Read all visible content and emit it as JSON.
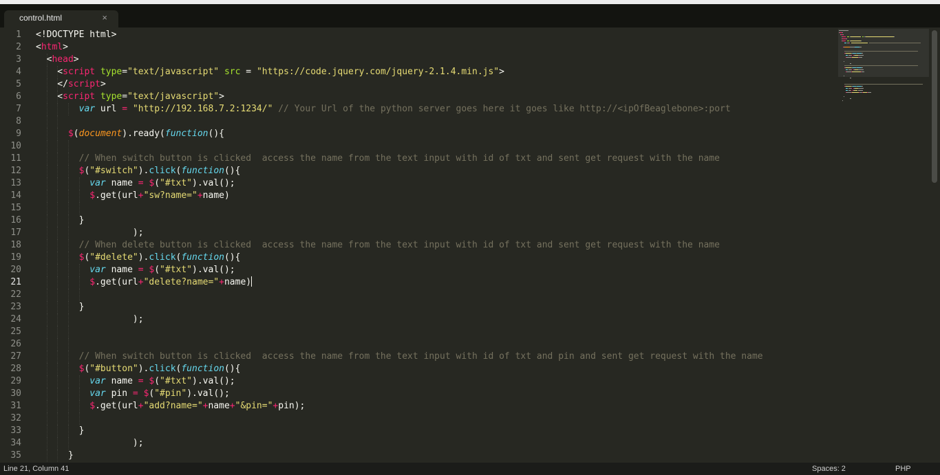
{
  "tab": {
    "title": "control.html",
    "close_glyph": "×"
  },
  "editor": {
    "active_line": 21,
    "lines": [
      {
        "n": "1",
        "tokens": [
          [
            "p",
            "<!DOCTYPE html>"
          ]
        ]
      },
      {
        "n": "2",
        "tokens": [
          [
            "p",
            "<"
          ],
          [
            "tag",
            "html"
          ],
          [
            "p",
            ">"
          ]
        ]
      },
      {
        "n": "3",
        "tokens": [
          [
            "p",
            "  <"
          ],
          [
            "tag",
            "head"
          ],
          [
            "p",
            ">"
          ]
        ]
      },
      {
        "n": "4",
        "tokens": [
          [
            "p",
            "    <"
          ],
          [
            "tag",
            "script"
          ],
          [
            "p",
            " "
          ],
          [
            "attr",
            "type"
          ],
          [
            "p",
            "="
          ],
          [
            "str",
            "\"text/javascript\""
          ],
          [
            "p",
            " "
          ],
          [
            "attr",
            "src"
          ],
          [
            "p",
            " = "
          ],
          [
            "str",
            "\"https://code.jquery.com/jquery-2.1.4.min.js\""
          ],
          [
            "p",
            ">"
          ]
        ]
      },
      {
        "n": "5",
        "tokens": [
          [
            "p",
            "    </"
          ],
          [
            "tag",
            "script"
          ],
          [
            "p",
            ">"
          ]
        ]
      },
      {
        "n": "6",
        "tokens": [
          [
            "p",
            "    <"
          ],
          [
            "tag",
            "script"
          ],
          [
            "p",
            " "
          ],
          [
            "attr",
            "type"
          ],
          [
            "p",
            "="
          ],
          [
            "str",
            "\"text/javascript\""
          ],
          [
            "p",
            ">"
          ]
        ]
      },
      {
        "n": "7",
        "tokens": [
          [
            "p",
            "        "
          ],
          [
            "kw",
            "var"
          ],
          [
            "p",
            " url "
          ],
          [
            "op",
            "="
          ],
          [
            "p",
            " "
          ],
          [
            "str",
            "\"http://192.168.7.2:1234/\""
          ],
          [
            "p",
            " "
          ],
          [
            "com",
            "// Your Url of the python server goes here it goes like http://<ipOfBeaglebone>:port"
          ]
        ]
      },
      {
        "n": "8",
        "tokens": []
      },
      {
        "n": "9",
        "tokens": [
          [
            "p",
            "      "
          ],
          [
            "op",
            "$"
          ],
          [
            "p",
            "("
          ],
          [
            "var",
            "document"
          ],
          [
            "p",
            ").ready("
          ],
          [
            "kw",
            "function"
          ],
          [
            "p",
            "(){"
          ]
        ]
      },
      {
        "n": "10",
        "tokens": []
      },
      {
        "n": "11",
        "tokens": [
          [
            "p",
            "        "
          ],
          [
            "com",
            "// When switch button is clicked  access the name from the text input with id of txt and sent get request with the name"
          ]
        ]
      },
      {
        "n": "12",
        "tokens": [
          [
            "p",
            "        "
          ],
          [
            "op",
            "$"
          ],
          [
            "p",
            "("
          ],
          [
            "str",
            "\"#switch\""
          ],
          [
            "p",
            ")."
          ],
          [
            "fn",
            "click"
          ],
          [
            "p",
            "("
          ],
          [
            "kw",
            "function"
          ],
          [
            "p",
            "(){"
          ]
        ]
      },
      {
        "n": "13",
        "tokens": [
          [
            "p",
            "          "
          ],
          [
            "kw",
            "var"
          ],
          [
            "p",
            " name "
          ],
          [
            "op",
            "="
          ],
          [
            "p",
            " "
          ],
          [
            "op",
            "$"
          ],
          [
            "p",
            "("
          ],
          [
            "str",
            "\"#txt\""
          ],
          [
            "p",
            ").val();"
          ]
        ]
      },
      {
        "n": "14",
        "tokens": [
          [
            "p",
            "          "
          ],
          [
            "op",
            "$"
          ],
          [
            "p",
            ".get(url"
          ],
          [
            "op",
            "+"
          ],
          [
            "str",
            "\"sw?name=\""
          ],
          [
            "op",
            "+"
          ],
          [
            "p",
            "name)"
          ]
        ]
      },
      {
        "n": "15",
        "tokens": []
      },
      {
        "n": "16",
        "tokens": [
          [
            "p",
            "        }"
          ]
        ]
      },
      {
        "n": "17",
        "tokens": [
          [
            "p",
            "                  );"
          ]
        ]
      },
      {
        "n": "18",
        "tokens": [
          [
            "p",
            "        "
          ],
          [
            "com",
            "// When delete button is clicked  access the name from the text input with id of txt and sent get request with the name"
          ]
        ]
      },
      {
        "n": "19",
        "tokens": [
          [
            "p",
            "        "
          ],
          [
            "op",
            "$"
          ],
          [
            "p",
            "("
          ],
          [
            "str",
            "\"#delete\""
          ],
          [
            "p",
            ")."
          ],
          [
            "fn",
            "click"
          ],
          [
            "p",
            "("
          ],
          [
            "kw",
            "function"
          ],
          [
            "p",
            "(){"
          ]
        ]
      },
      {
        "n": "20",
        "tokens": [
          [
            "p",
            "          "
          ],
          [
            "kw",
            "var"
          ],
          [
            "p",
            " name "
          ],
          [
            "op",
            "="
          ],
          [
            "p",
            " "
          ],
          [
            "op",
            "$"
          ],
          [
            "p",
            "("
          ],
          [
            "str",
            "\"#txt\""
          ],
          [
            "p",
            ").val();"
          ]
        ]
      },
      {
        "n": "21",
        "tokens": [
          [
            "p",
            "          "
          ],
          [
            "op",
            "$"
          ],
          [
            "p",
            ".get(url"
          ],
          [
            "op",
            "+"
          ],
          [
            "str",
            "\"delete?name=\""
          ],
          [
            "op",
            "+"
          ],
          [
            "p",
            "name)"
          ]
        ]
      },
      {
        "n": "22",
        "tokens": []
      },
      {
        "n": "23",
        "tokens": [
          [
            "p",
            "        }"
          ]
        ]
      },
      {
        "n": "24",
        "tokens": [
          [
            "p",
            "                  );"
          ]
        ]
      },
      {
        "n": "25",
        "tokens": []
      },
      {
        "n": "26",
        "tokens": []
      },
      {
        "n": "27",
        "tokens": [
          [
            "p",
            "        "
          ],
          [
            "com",
            "// When switch button is clicked  access the name from the text input with id of txt and pin and sent get request with the name"
          ]
        ]
      },
      {
        "n": "28",
        "tokens": [
          [
            "p",
            "        "
          ],
          [
            "op",
            "$"
          ],
          [
            "p",
            "("
          ],
          [
            "str",
            "\"#button\""
          ],
          [
            "p",
            ")."
          ],
          [
            "fn",
            "click"
          ],
          [
            "p",
            "("
          ],
          [
            "kw",
            "function"
          ],
          [
            "p",
            "(){"
          ]
        ]
      },
      {
        "n": "29",
        "tokens": [
          [
            "p",
            "          "
          ],
          [
            "kw",
            "var"
          ],
          [
            "p",
            " name "
          ],
          [
            "op",
            "="
          ],
          [
            "p",
            " "
          ],
          [
            "op",
            "$"
          ],
          [
            "p",
            "("
          ],
          [
            "str",
            "\"#txt\""
          ],
          [
            "p",
            ").val();"
          ]
        ]
      },
      {
        "n": "30",
        "tokens": [
          [
            "p",
            "          "
          ],
          [
            "kw",
            "var"
          ],
          [
            "p",
            " pin "
          ],
          [
            "op",
            "="
          ],
          [
            "p",
            " "
          ],
          [
            "op",
            "$"
          ],
          [
            "p",
            "("
          ],
          [
            "str",
            "\"#pin\""
          ],
          [
            "p",
            ").val();"
          ]
        ]
      },
      {
        "n": "31",
        "tokens": [
          [
            "p",
            "          "
          ],
          [
            "op",
            "$"
          ],
          [
            "p",
            ".get(url"
          ],
          [
            "op",
            "+"
          ],
          [
            "str",
            "\"add?name=\""
          ],
          [
            "op",
            "+"
          ],
          [
            "p",
            "name"
          ],
          [
            "op",
            "+"
          ],
          [
            "str",
            "\"&pin=\""
          ],
          [
            "op",
            "+"
          ],
          [
            "p",
            "pin);"
          ]
        ]
      },
      {
        "n": "32",
        "tokens": []
      },
      {
        "n": "33",
        "tokens": [
          [
            "p",
            "        }"
          ]
        ]
      },
      {
        "n": "34",
        "tokens": [
          [
            "p",
            "                  );"
          ]
        ]
      },
      {
        "n": "35",
        "tokens": [
          [
            "p",
            "      }"
          ]
        ]
      }
    ]
  },
  "status": {
    "position": "Line 21, Column 41",
    "indent": "Spaces: 2",
    "syntax": "PHP"
  },
  "colors": {
    "background": "#272822",
    "tag": "#f92672",
    "string": "#e6db74",
    "keyword": "#66d9ef",
    "attribute": "#a6e22e",
    "comment": "#75715e"
  }
}
